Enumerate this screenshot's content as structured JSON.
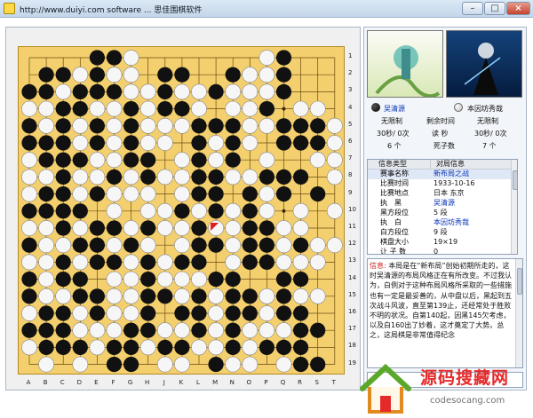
{
  "window": {
    "title": "http://www.duiyi.com software ... 思佳围棋软件",
    "controls": {
      "minimize": "–",
      "maximize": "□",
      "close": "×"
    }
  },
  "board": {
    "column_labels": [
      "A",
      "B",
      "C",
      "D",
      "E",
      "F",
      "G",
      "H",
      "J",
      "K",
      "L",
      "M",
      "N",
      "O",
      "P",
      "Q",
      "R",
      "S",
      "T"
    ],
    "row_labels": [
      "1",
      "2",
      "3",
      "4",
      "5",
      "6",
      "7",
      "8",
      "9",
      "10",
      "11",
      "12",
      "13",
      "14",
      "15",
      "16",
      "17",
      "18",
      "19"
    ],
    "board_color": "#f4cf6e",
    "last_move_marker_color": "#e21b1b"
  },
  "players": {
    "black": {
      "name": "吴清源",
      "time_left": "无限制",
      "byoyomi": "30秒/ 0次",
      "captured": "6 个",
      "color": "#000000"
    },
    "white": {
      "name": "本因坊秀哉",
      "time_left": "无限制",
      "byoyomi": "30秒/ 0次",
      "captured": "7 个",
      "color": "#ffffff"
    },
    "center": {
      "remaining_label": "剩余时间",
      "byoyomi_label": "读  秒",
      "captured_label": "死子数"
    }
  },
  "info_table": {
    "headers": [
      "信息类型",
      "对局信息"
    ],
    "rows": [
      {
        "key": "赛事名称",
        "value": "新布局之战",
        "selected": true
      },
      {
        "key": "比赛时间",
        "value": "1933-10-16"
      },
      {
        "key": "比赛地点",
        "value": "日本 东京"
      },
      {
        "key": "执　黑",
        "value": "吴清源"
      },
      {
        "key": "黑方段位",
        "value": "5 段"
      },
      {
        "key": "执　白",
        "value": "本因坊秀哉"
      },
      {
        "key": "白方段位",
        "value": "9 段"
      },
      {
        "key": "棋盘大小",
        "value": "19×19"
      },
      {
        "key": "让 子 数",
        "value": "0"
      }
    ]
  },
  "comment": {
    "label": "信息:",
    "text": " 本局是在“新布局”创始初期所走的，这时吴清源的布局风格正在有所改变。不过我认为，白例对于这种布局风格所采取的一些措施也有一定是最妥善的，从中盘以后，黑起到五次战斗风波，直至第139止，还经常处于胜败不明的状况。自第140起，因黑145欠考虑，以及白160出了妙着，这才奠定了大势。总之，这局棋是非常值得纪念"
  },
  "watermark": {
    "text": "源码搜藏网",
    "url": "codesocang.com"
  }
}
